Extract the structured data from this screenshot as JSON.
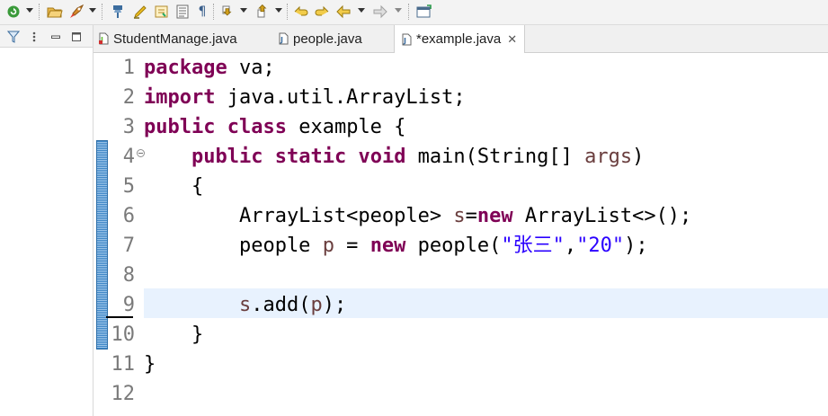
{
  "toolbar": {
    "icons": [
      "run-icon",
      "open-folder-icon",
      "rocket-icon",
      "pin-icon",
      "marker-icon",
      "toggle-icon",
      "outline-icon",
      "pilcrow-icon",
      "next-annotation-icon",
      "prev-annotation-icon",
      "last-edit-icon",
      "back-icon",
      "forward-icon",
      "new-window-icon"
    ]
  },
  "left_panel": {
    "icons": [
      "filter-icon",
      "view-menu-icon",
      "minimize-icon",
      "maximize-icon"
    ]
  },
  "tabs": [
    {
      "label": "StudentManage.java",
      "active": false
    },
    {
      "label": "people.java",
      "active": false
    },
    {
      "label": "*example.java",
      "active": true,
      "close": "✕"
    }
  ],
  "editor": {
    "line_numbers": [
      "1",
      "2",
      "3",
      "4",
      "5",
      "6",
      "7",
      "8",
      "9",
      "10",
      "11",
      "12"
    ],
    "current_line": "9",
    "lines": [
      {
        "tokens": [
          {
            "t": "package",
            "c": "kw"
          },
          {
            "t": " va;"
          }
        ]
      },
      {
        "tokens": [
          {
            "t": "import",
            "c": "kw"
          },
          {
            "t": " java.util.ArrayList;"
          }
        ]
      },
      {
        "tokens": [
          {
            "t": "public",
            "c": "kw"
          },
          {
            "t": " "
          },
          {
            "t": "class",
            "c": "kw"
          },
          {
            "t": " example {"
          }
        ]
      },
      {
        "tokens": [
          {
            "t": "    "
          },
          {
            "t": "public",
            "c": "kw"
          },
          {
            "t": " "
          },
          {
            "t": "static",
            "c": "kw"
          },
          {
            "t": " "
          },
          {
            "t": "void",
            "c": "kw"
          },
          {
            "t": " main(String[] "
          },
          {
            "t": "args",
            "c": "var"
          },
          {
            "t": ")"
          }
        ]
      },
      {
        "tokens": [
          {
            "t": "    {"
          }
        ]
      },
      {
        "tokens": [
          {
            "t": "        ArrayList<people> "
          },
          {
            "t": "s",
            "c": "var"
          },
          {
            "t": "="
          },
          {
            "t": "new",
            "c": "kw"
          },
          {
            "t": " ArrayList<>();"
          }
        ]
      },
      {
        "tokens": [
          {
            "t": "        people "
          },
          {
            "t": "p",
            "c": "var"
          },
          {
            "t": " = "
          },
          {
            "t": "new",
            "c": "kw"
          },
          {
            "t": " people("
          },
          {
            "t": "\"张三\"",
            "c": "str"
          },
          {
            "t": ","
          },
          {
            "t": "\"20\"",
            "c": "str"
          },
          {
            "t": ");"
          }
        ]
      },
      {
        "tokens": []
      },
      {
        "tokens": [
          {
            "t": "        "
          },
          {
            "t": "s",
            "c": "var"
          },
          {
            "t": ".add("
          },
          {
            "t": "p",
            "c": "var"
          },
          {
            "t": ");"
          }
        ]
      },
      {
        "tokens": [
          {
            "t": "    }"
          }
        ]
      },
      {
        "tokens": [
          {
            "t": "}"
          }
        ]
      },
      {
        "tokens": []
      }
    ]
  },
  "colors": {
    "keyword": "#7f0055",
    "variable": "#6a3e3e",
    "string": "#2a00ff",
    "current_line": "#e8f2fe",
    "change_bar": "#3f87c7"
  }
}
